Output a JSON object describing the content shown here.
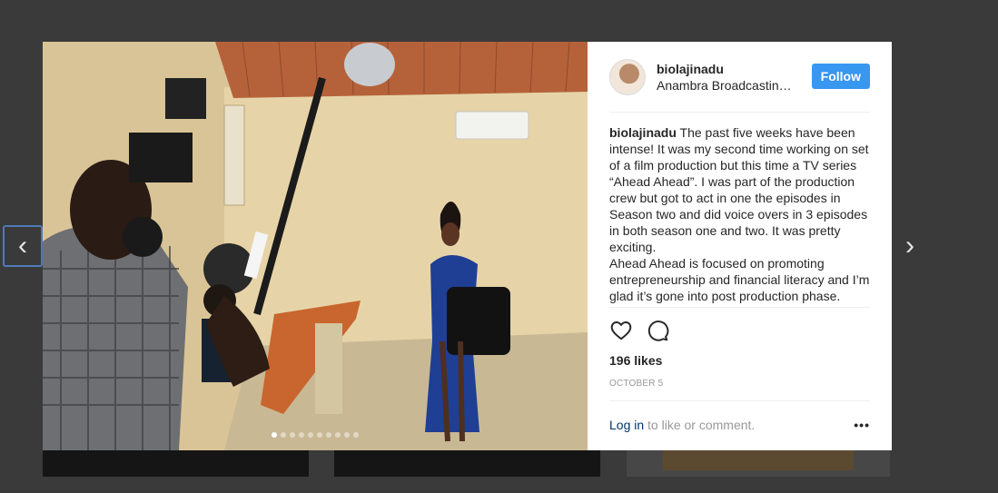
{
  "post": {
    "username": "biolajinadu",
    "location": "Anambra Broadcastin…",
    "follow_label": "Follow",
    "caption_user": "biolajinadu",
    "caption_line1": "The past five weeks have been intense! It was my second time working on set of a film production but this time a TV series “Ahead Ahead”. I was part of the production crew but got to act in one the episodes in Season two and did voice overs in 3 episodes in both season one and two. It was pretty exciting.",
    "caption_line2": "Ahead Ahead is focused on promoting entrepreneurship and financial literacy and I’m glad it’s gone into post production phase.",
    "likes": "196 likes",
    "date": "OCTOBER 5",
    "login_link": "Log in",
    "login_suffix": " to like or comment.",
    "more": "•••"
  },
  "carousel": {
    "total_images": 10,
    "active_index": 0
  },
  "navigation": {
    "prev": "‹",
    "next": "›"
  },
  "colors": {
    "follow_button": "#3897f0",
    "link": "#003569",
    "muted": "#999999",
    "backdrop": "#3a3a3a"
  }
}
